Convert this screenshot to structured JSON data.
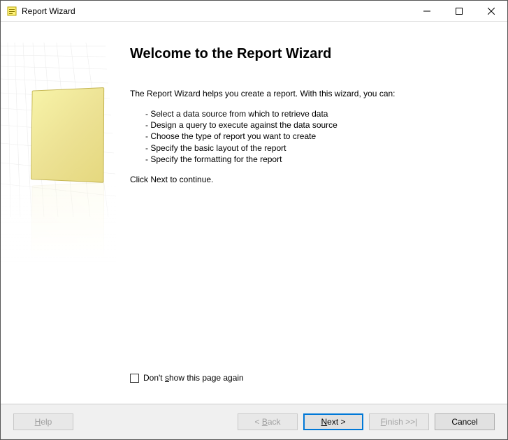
{
  "window": {
    "title": "Report Wizard"
  },
  "main": {
    "heading": "Welcome to the Report Wizard",
    "intro": "The Report Wizard helps you create a report. With this wizard, you can:",
    "bullets": [
      "Select a data source from which to retrieve data",
      "Design a query to execute against the data source",
      "Choose the type of report you want to create",
      "Specify the basic layout of the report",
      "Specify the formatting for the report"
    ],
    "continue": "Click Next to continue.",
    "checkbox_label_pre": "Don't ",
    "checkbox_label_u": "s",
    "checkbox_label_post": "how this page again"
  },
  "buttons": {
    "help_u": "H",
    "help_post": "elp",
    "back_pre": "< ",
    "back_u": "B",
    "back_post": "ack",
    "next_u": "N",
    "next_post": "ext >",
    "finish_u": "F",
    "finish_post": "inish >>|",
    "cancel": "Cancel"
  }
}
